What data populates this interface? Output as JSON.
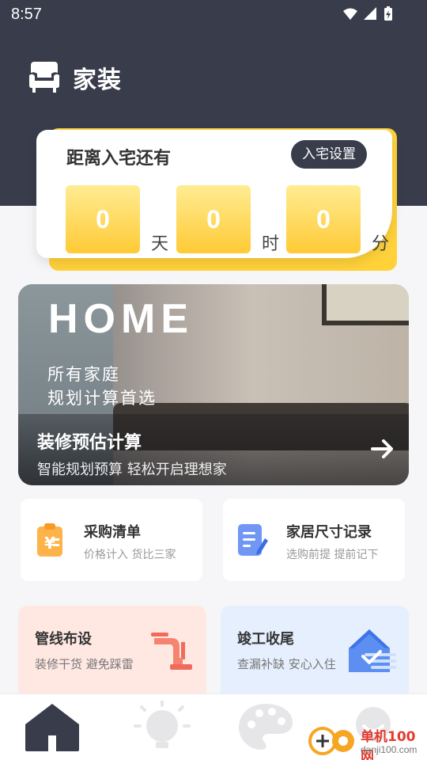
{
  "status_bar": {
    "time": "8:57"
  },
  "header": {
    "title": "家装",
    "icon": "sofa-icon"
  },
  "countdown": {
    "title": "距离入宅还有",
    "setting_label": "入宅设置",
    "days": "0",
    "days_unit": "天",
    "hours": "0",
    "hours_unit": "时",
    "minutes": "0",
    "minutes_unit": "分"
  },
  "banner": {
    "headline": "HOME",
    "subtitle_line1": "所有家庭",
    "subtitle_line2": "规划计算首选",
    "title": "装修预估计算",
    "desc": "智能规划预算 轻松开启理想家"
  },
  "tiles": [
    {
      "title": "采购清单",
      "desc": "价格计入 货比三家",
      "icon": "clipboard-icon"
    },
    {
      "title": "家居尺寸记录",
      "desc": "选购前提 提前记下",
      "icon": "note-edit-icon"
    }
  ],
  "features": [
    {
      "title": "管线布设",
      "desc": "装修干货 避免踩雷",
      "icon": "pipe-icon",
      "bg": "#ffe8e2"
    },
    {
      "title": "竣工收尾",
      "desc": "查漏补缺 安心入住",
      "icon": "house-check-icon",
      "bg": "#e5effd"
    }
  ],
  "nav": [
    {
      "name": "home",
      "icon": "home-icon",
      "active": true
    },
    {
      "name": "idea",
      "icon": "lightbulb-icon",
      "active": false
    },
    {
      "name": "palette",
      "icon": "palette-icon",
      "active": false
    },
    {
      "name": "profile",
      "icon": "profile-icon",
      "active": false
    }
  ],
  "watermark": {
    "text1": "单机100网",
    "text2": "danji100.com"
  },
  "colors": {
    "header_bg": "#383c4b",
    "accent_yellow": "#ffca35",
    "text_dark": "#333333"
  }
}
